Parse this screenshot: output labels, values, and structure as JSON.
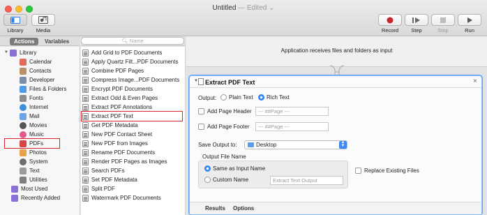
{
  "window": {
    "title": "Untitled",
    "edited": "— Edited ⌄"
  },
  "toolbar": {
    "left": [
      {
        "label": "Library",
        "icon": "library-icon"
      },
      {
        "label": "Media",
        "icon": "media-icon"
      }
    ],
    "right": [
      {
        "label": "Record",
        "icon": "record-icon"
      },
      {
        "label": "Step",
        "icon": "step-icon"
      },
      {
        "label": "Stop",
        "icon": "stop-icon"
      },
      {
        "label": "Run",
        "icon": "run-icon"
      }
    ]
  },
  "library_tabs": {
    "actions": "Actions",
    "variables": "Variables"
  },
  "search": {
    "placeholder": "Name"
  },
  "library": {
    "items": [
      {
        "label": "Library",
        "color": "#8a6fd6"
      },
      {
        "label": "Calendar",
        "color": "#e46b5c"
      },
      {
        "label": "Contacts",
        "color": "#b9926a"
      },
      {
        "label": "Developer",
        "color": "#7a8ea8"
      },
      {
        "label": "Files & Folders",
        "color": "#4f9be8"
      },
      {
        "label": "Fonts",
        "color": "#8d8d8d"
      },
      {
        "label": "Internet",
        "color": "#3d8fd8"
      },
      {
        "label": "Mail",
        "color": "#6aa3e6"
      },
      {
        "label": "Movies",
        "color": "#555555"
      },
      {
        "label": "Music",
        "color": "#e05a8a"
      },
      {
        "label": "PDFs",
        "color": "#d64646"
      },
      {
        "label": "Photos",
        "color": "#e8a34a"
      },
      {
        "label": "System",
        "color": "#6d6d6d"
      },
      {
        "label": "Text",
        "color": "#9b9b9b"
      },
      {
        "label": "Utilities",
        "color": "#7f7f7f"
      },
      {
        "label": "Most Used",
        "color": "#8a6fd6"
      },
      {
        "label": "Recently Added",
        "color": "#8a6fd6"
      }
    ]
  },
  "actions": {
    "items": [
      "Add Grid to PDF Documents",
      "Apply Quartz Filt...PDF Documents",
      "Combine PDF Pages",
      "Compress Image...PDF Documents",
      "Encrypt PDF Documents",
      "Extract Odd & Even Pages",
      "Extract PDF Annotations",
      "Extract PDF Text",
      "Get PDF Metadata",
      "New PDF Contact Sheet",
      "New PDF from Images",
      "Rename PDF Documents",
      "Render PDF Pages as Images",
      "Search PDFs",
      "Set PDF Metadata",
      "Split PDF",
      "Watermark PDF Documents"
    ]
  },
  "workflow": {
    "receives_text": "Application receives files and folders as input",
    "action_card": {
      "title": "Extract PDF Text",
      "output_label": "Output:",
      "plain_text": "Plain Text",
      "rich_text": "Rich Text",
      "add_page_header": "Add Page Header",
      "page_header_placeholder": "--- ##Page ---",
      "add_page_footer": "Add Page Footer",
      "page_footer_placeholder": "--- ##Page ---",
      "save_output_label": "Save Output to:",
      "save_output_value": "Desktop",
      "output_file_name_label": "Output File Name",
      "same_as_input": "Same as Input Name",
      "custom_name": "Custom Name",
      "custom_name_placeholder": "Extract Text Output",
      "replace_existing": "Replace Existing Files",
      "footer_results": "Results",
      "footer_options": "Options"
    }
  },
  "colors": {
    "highlight": "#d9232e",
    "accent": "#3b8af5"
  }
}
